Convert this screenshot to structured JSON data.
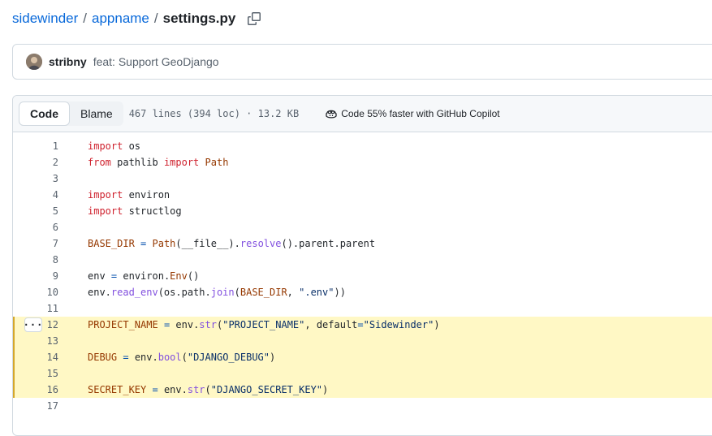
{
  "breadcrumb": {
    "repo": "sidewinder",
    "folder": "appname",
    "separator": "/",
    "file": "settings.py",
    "copy_icon": "copy-icon"
  },
  "commit": {
    "author": "stribny",
    "message": "feat: Support GeoDjango",
    "avatar_icon": "avatar"
  },
  "file_header": {
    "tabs": [
      {
        "label": "Code",
        "active": true
      },
      {
        "label": "Blame",
        "active": false
      }
    ],
    "info": "467 lines (394 loc) · 13.2 KB",
    "copilot_label": "Code 55% faster with GitHub Copilot",
    "copilot_icon": "copilot-icon"
  },
  "code": {
    "highlight_color": "#fff8c5",
    "lines": [
      {
        "n": "1",
        "text": "import os"
      },
      {
        "n": "2",
        "text": "from pathlib import Path"
      },
      {
        "n": "3",
        "text": ""
      },
      {
        "n": "4",
        "text": "import environ"
      },
      {
        "n": "5",
        "text": "import structlog"
      },
      {
        "n": "6",
        "text": ""
      },
      {
        "n": "7",
        "text": "BASE_DIR = Path(__file__).resolve().parent.parent"
      },
      {
        "n": "8",
        "text": ""
      },
      {
        "n": "9",
        "text": "env = environ.Env()"
      },
      {
        "n": "10",
        "text": "env.read_env(os.path.join(BASE_DIR, \".env\"))"
      },
      {
        "n": "11",
        "text": ""
      },
      {
        "n": "12",
        "text": "PROJECT_NAME = env.str(\"PROJECT_NAME\", default=\"Sidewinder\")"
      },
      {
        "n": "13",
        "text": ""
      },
      {
        "n": "14",
        "text": "DEBUG = env.bool(\"DJANGO_DEBUG\")"
      },
      {
        "n": "15",
        "text": ""
      },
      {
        "n": "16",
        "text": "SECRET_KEY = env.str(\"DJANGO_SECRET_KEY\")"
      },
      {
        "n": "17",
        "text": ""
      }
    ]
  }
}
